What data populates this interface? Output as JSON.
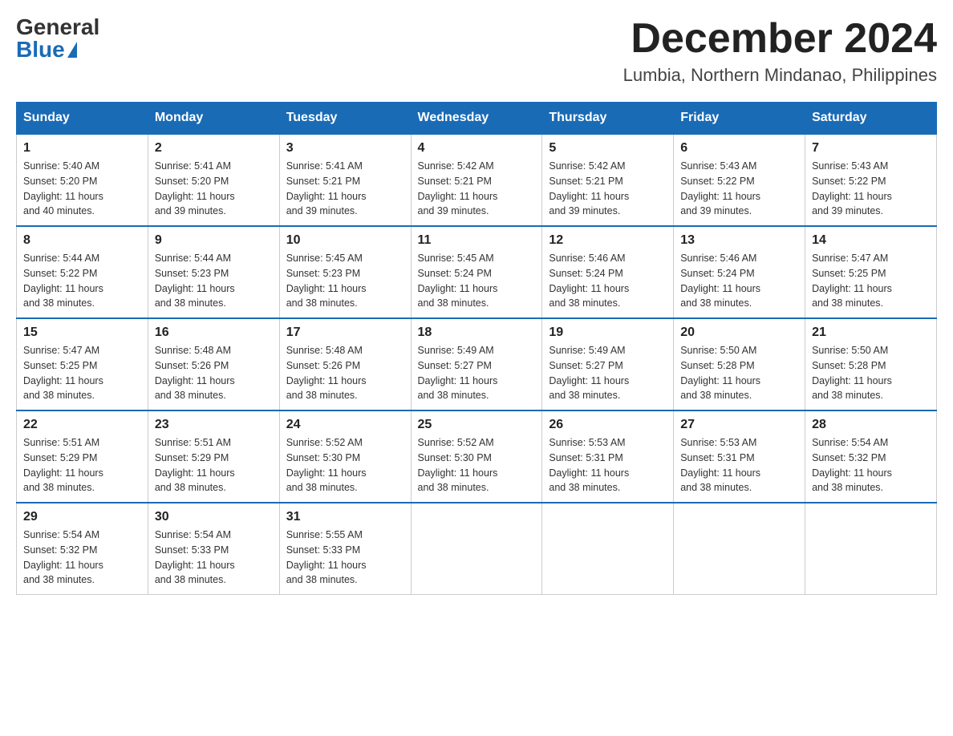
{
  "logo": {
    "general": "General",
    "blue": "Blue"
  },
  "title": {
    "month": "December 2024",
    "location": "Lumbia, Northern Mindanao, Philippines"
  },
  "weekdays": [
    "Sunday",
    "Monday",
    "Tuesday",
    "Wednesday",
    "Thursday",
    "Friday",
    "Saturday"
  ],
  "weeks": [
    [
      {
        "day": "1",
        "sunrise": "5:40 AM",
        "sunset": "5:20 PM",
        "daylight": "11 hours and 40 minutes."
      },
      {
        "day": "2",
        "sunrise": "5:41 AM",
        "sunset": "5:20 PM",
        "daylight": "11 hours and 39 minutes."
      },
      {
        "day": "3",
        "sunrise": "5:41 AM",
        "sunset": "5:21 PM",
        "daylight": "11 hours and 39 minutes."
      },
      {
        "day": "4",
        "sunrise": "5:42 AM",
        "sunset": "5:21 PM",
        "daylight": "11 hours and 39 minutes."
      },
      {
        "day": "5",
        "sunrise": "5:42 AM",
        "sunset": "5:21 PM",
        "daylight": "11 hours and 39 minutes."
      },
      {
        "day": "6",
        "sunrise": "5:43 AM",
        "sunset": "5:22 PM",
        "daylight": "11 hours and 39 minutes."
      },
      {
        "day": "7",
        "sunrise": "5:43 AM",
        "sunset": "5:22 PM",
        "daylight": "11 hours and 39 minutes."
      }
    ],
    [
      {
        "day": "8",
        "sunrise": "5:44 AM",
        "sunset": "5:22 PM",
        "daylight": "11 hours and 38 minutes."
      },
      {
        "day": "9",
        "sunrise": "5:44 AM",
        "sunset": "5:23 PM",
        "daylight": "11 hours and 38 minutes."
      },
      {
        "day": "10",
        "sunrise": "5:45 AM",
        "sunset": "5:23 PM",
        "daylight": "11 hours and 38 minutes."
      },
      {
        "day": "11",
        "sunrise": "5:45 AM",
        "sunset": "5:24 PM",
        "daylight": "11 hours and 38 minutes."
      },
      {
        "day": "12",
        "sunrise": "5:46 AM",
        "sunset": "5:24 PM",
        "daylight": "11 hours and 38 minutes."
      },
      {
        "day": "13",
        "sunrise": "5:46 AM",
        "sunset": "5:24 PM",
        "daylight": "11 hours and 38 minutes."
      },
      {
        "day": "14",
        "sunrise": "5:47 AM",
        "sunset": "5:25 PM",
        "daylight": "11 hours and 38 minutes."
      }
    ],
    [
      {
        "day": "15",
        "sunrise": "5:47 AM",
        "sunset": "5:25 PM",
        "daylight": "11 hours and 38 minutes."
      },
      {
        "day": "16",
        "sunrise": "5:48 AM",
        "sunset": "5:26 PM",
        "daylight": "11 hours and 38 minutes."
      },
      {
        "day": "17",
        "sunrise": "5:48 AM",
        "sunset": "5:26 PM",
        "daylight": "11 hours and 38 minutes."
      },
      {
        "day": "18",
        "sunrise": "5:49 AM",
        "sunset": "5:27 PM",
        "daylight": "11 hours and 38 minutes."
      },
      {
        "day": "19",
        "sunrise": "5:49 AM",
        "sunset": "5:27 PM",
        "daylight": "11 hours and 38 minutes."
      },
      {
        "day": "20",
        "sunrise": "5:50 AM",
        "sunset": "5:28 PM",
        "daylight": "11 hours and 38 minutes."
      },
      {
        "day": "21",
        "sunrise": "5:50 AM",
        "sunset": "5:28 PM",
        "daylight": "11 hours and 38 minutes."
      }
    ],
    [
      {
        "day": "22",
        "sunrise": "5:51 AM",
        "sunset": "5:29 PM",
        "daylight": "11 hours and 38 minutes."
      },
      {
        "day": "23",
        "sunrise": "5:51 AM",
        "sunset": "5:29 PM",
        "daylight": "11 hours and 38 minutes."
      },
      {
        "day": "24",
        "sunrise": "5:52 AM",
        "sunset": "5:30 PM",
        "daylight": "11 hours and 38 minutes."
      },
      {
        "day": "25",
        "sunrise": "5:52 AM",
        "sunset": "5:30 PM",
        "daylight": "11 hours and 38 minutes."
      },
      {
        "day": "26",
        "sunrise": "5:53 AM",
        "sunset": "5:31 PM",
        "daylight": "11 hours and 38 minutes."
      },
      {
        "day": "27",
        "sunrise": "5:53 AM",
        "sunset": "5:31 PM",
        "daylight": "11 hours and 38 minutes."
      },
      {
        "day": "28",
        "sunrise": "5:54 AM",
        "sunset": "5:32 PM",
        "daylight": "11 hours and 38 minutes."
      }
    ],
    [
      {
        "day": "29",
        "sunrise": "5:54 AM",
        "sunset": "5:32 PM",
        "daylight": "11 hours and 38 minutes."
      },
      {
        "day": "30",
        "sunrise": "5:54 AM",
        "sunset": "5:33 PM",
        "daylight": "11 hours and 38 minutes."
      },
      {
        "day": "31",
        "sunrise": "5:55 AM",
        "sunset": "5:33 PM",
        "daylight": "11 hours and 38 minutes."
      },
      null,
      null,
      null,
      null
    ]
  ],
  "labels": {
    "sunrise": "Sunrise:",
    "sunset": "Sunset:",
    "daylight": "Daylight:"
  }
}
